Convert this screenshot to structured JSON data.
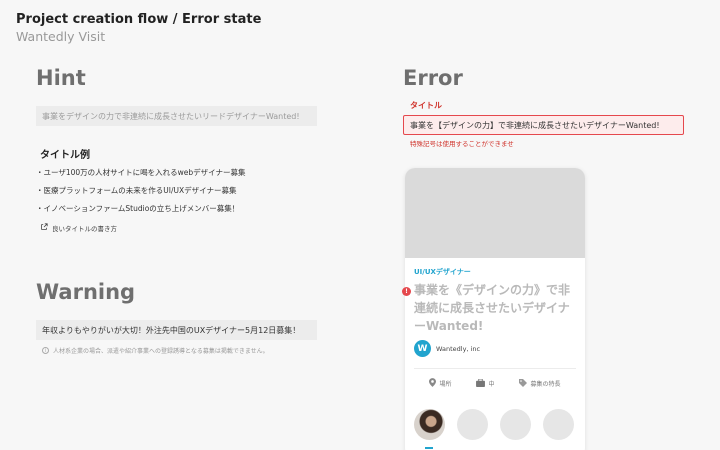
{
  "header": {
    "title": "Project creation flow / Error state",
    "subtitle": "Wantedly Visit"
  },
  "hint": {
    "heading": "Hint",
    "placeholder": "事業をデザインの力で非連続に成長させたいリードデザイナーWanted!",
    "examples_title": "タイトル例",
    "examples": [
      "・ユーザ100万の人材サイトに喝を入れるwebデザイナー募集",
      "・医療プラットフォームの未来を作るUI/UXデザイナー募集",
      "・イノベーションファームStudioの立ち上げメンバー募集！"
    ],
    "guide_link": "良いタイトルの書き方",
    "guide_icon": "external-link-icon"
  },
  "warning": {
    "heading": "Warning",
    "value": "年収よりもやりがいが大切！外注先中国のUXデザイナー5月12日募集！",
    "note": "人材系企業の場合、派遣や紹介事業への登録誘導となる募集は掲載できません。",
    "note_icon": "info-icon"
  },
  "error": {
    "heading": "Error",
    "field_label": "タイトル",
    "field_value": "事業を【デザインの力】で非連続に成長させたいデザイナーWanted!",
    "message": "特殊記号は使用することができませ",
    "error_icon": "alert-icon",
    "error_icon_glyph": "!"
  },
  "card": {
    "category": "UI/UXデザイナー",
    "title": "事業を《デザインの力》で非連続に成長させたいデザイナーWanted!",
    "company_logo": "W",
    "company_name": "Wantedly, inc",
    "meta": [
      {
        "icon": "location-pin-icon",
        "label": "場所"
      },
      {
        "icon": "briefcase-icon",
        "label": "中"
      },
      {
        "icon": "tag-icon",
        "label": "募集の特長"
      }
    ]
  },
  "colors": {
    "accent": "#21a4ce",
    "error": "#e5484d",
    "error_text": "#d0342c",
    "heading_grey": "#6f6f6f"
  }
}
